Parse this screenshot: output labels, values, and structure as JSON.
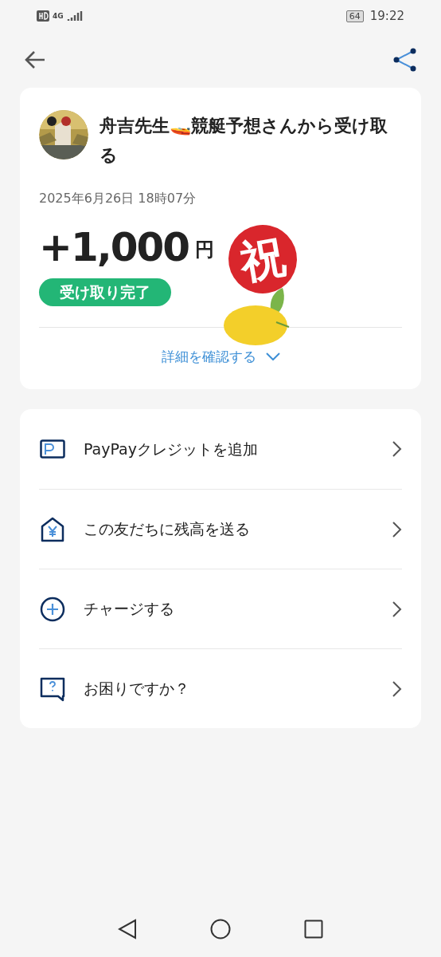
{
  "status_bar": {
    "network": "4G",
    "battery": "64",
    "time": "19:22"
  },
  "transaction": {
    "title": "舟吉先生🚤競艇予想さんから受け取る",
    "datetime": "2025年6月26日 18時07分",
    "amount": "+1,000",
    "currency": "円",
    "status": "受け取り完了",
    "details_link": "詳細を確認する",
    "sticker": "祝"
  },
  "actions": [
    {
      "kind": "card",
      "label": "PayPayクレジットを追加"
    },
    {
      "kind": "send",
      "label": "この友だちに残高を送る"
    },
    {
      "kind": "charge",
      "label": "チャージする"
    },
    {
      "kind": "help",
      "label": "お困りですか？"
    }
  ]
}
